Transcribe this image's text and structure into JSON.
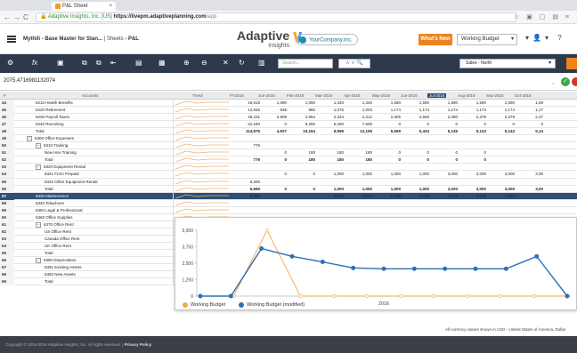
{
  "browser": {
    "tab_title": "P&L Sheet",
    "url_lock": "Adaptive Insights, Inc. [US]",
    "url_domain": "https://livepm.adaptiveplanning.com",
    "url_path": "/app"
  },
  "header": {
    "breadcrumb_model": "Mythili - Base Master for Stan...",
    "breadcrumb_sheets": "Sheets",
    "breadcrumb_page": "P&L",
    "logo_main": "Adaptive",
    "logo_sub": "insights",
    "company_logo": "YourCompany.inc.",
    "whats_new": "What's New",
    "version_select": "Working Budget"
  },
  "toolbar": {
    "search_placeholder": "Search...",
    "region_select": "Sales - North"
  },
  "formula_bar": {
    "value": "2075.4716981132074"
  },
  "grid": {
    "headers": {
      "rownum": "#",
      "accounts": "Accounts",
      "trend": "Trend",
      "fy": "FY2015",
      "months": [
        "Jun-2016",
        "Feb-2016",
        "Mar-2016",
        "Apr-2016",
        "May-2016",
        "Jun-2016",
        "Jul-2016",
        "Aug-2016",
        "Sep-2016",
        "Oct-2016"
      ]
    },
    "rows": [
      {
        "num": "44",
        "label": "6210 Health Benefits",
        "indent": 2,
        "fy": "19,818",
        "v": [
          "1,090",
          "1,090",
          "1,340",
          "1,340",
          "1,590",
          "1,590",
          "1,590",
          "1,590",
          "1,590",
          "1,59"
        ]
      },
      {
        "num": "45",
        "label": "6220 Retirement",
        "indent": 2,
        "fy": "14,946",
        "v": [
          "938",
          "960",
          "1,075",
          "1,003",
          "1,174",
          "1,174",
          "1,174",
          "1,174",
          "1,174",
          "1,17"
        ]
      },
      {
        "num": "46",
        "label": "6230 Payroll Taxes",
        "indent": 2,
        "fy": "49,231",
        "v": [
          "2,909",
          "2,864",
          "2,334",
          "2,312",
          "2,805",
          "2,669",
          "2,380",
          "2,379",
          "2,379",
          "2,37"
        ]
      },
      {
        "num": "47",
        "label": "6240 Recruiting",
        "indent": 2,
        "fy": "31,180",
        "v": [
          "0",
          "5,250",
          "5,250",
          "7,500",
          "0",
          "0",
          "0",
          "0",
          "0",
          "0"
        ]
      },
      {
        "num": "48",
        "label": "Total",
        "indent": 2,
        "fy": "114,976",
        "bold": true,
        "v": [
          "4,937",
          "10,164",
          "9,999",
          "12,155",
          "5,569",
          "5,434",
          "5,145",
          "5,143",
          "5,143",
          "5,14"
        ]
      },
      {
        "num": "49",
        "label": "6300 Office Expenses",
        "indent": 1,
        "toggle": "−",
        "fy": "",
        "v": [
          "",
          "",
          "",
          "",
          "",
          "",
          "",
          "",
          "",
          ""
        ]
      },
      {
        "num": "50",
        "label": "6310 Training",
        "indent": 2,
        "toggle": "−",
        "fy": "776",
        "v": [
          "",
          "",
          "",
          "",
          "",
          "",
          "",
          "",
          "",
          ""
        ]
      },
      {
        "num": "51",
        "label": "New Hire Training",
        "indent": 3,
        "fy": "",
        "v": [
          "0",
          "180",
          "180",
          "180",
          "0",
          "0",
          "0",
          "0",
          "",
          ""
        ]
      },
      {
        "num": "52",
        "label": "Total",
        "indent": 3,
        "fy": "776",
        "bold": true,
        "v": [
          "0",
          "180",
          "180",
          "180",
          "0",
          "0",
          "0",
          "0",
          "",
          ""
        ]
      },
      {
        "num": "53",
        "label": "6320 Equipment Rental",
        "indent": 2,
        "toggle": "−",
        "fy": "",
        "v": [
          "",
          "",
          "",
          "",
          "",
          "",
          "",
          "",
          "",
          ""
        ]
      },
      {
        "num": "54",
        "label": "6321 From Prepaid",
        "indent": 3,
        "fy": "",
        "v": [
          "0",
          "0",
          "1,000",
          "1,000",
          "1,000",
          "1,000",
          "3,000",
          "3,000",
          "3,000",
          "3,00"
        ]
      },
      {
        "num": "55",
        "label": "6322 Other Equipment Rental",
        "indent": 3,
        "fy": "6,590",
        "v": [
          "",
          "",
          "",
          "",
          "",
          "",
          "",
          "",
          "",
          ""
        ]
      },
      {
        "num": "56",
        "label": "Total",
        "indent": 3,
        "fy": "6,590",
        "bold": true,
        "v": [
          "0",
          "0",
          "1,000",
          "1,000",
          "1,000",
          "1,000",
          "3,000",
          "3,000",
          "3,000",
          "3,00"
        ]
      },
      {
        "num": "57",
        "label": "6330 Maintenance",
        "indent": 2,
        "selected": true,
        "fy": "3,700",
        "v": [
          "",
          "",
          "3,616",
          "3,019",
          "2,138",
          "2,075",
          "2,075",
          "2,075",
          "3,019",
          ""
        ]
      },
      {
        "num": "58",
        "label": "6340 Telephone",
        "indent": 2,
        "fy": "",
        "v": [
          "",
          "",
          "",
          "",
          "",
          "",
          "",
          "",
          "",
          ""
        ]
      },
      {
        "num": "59",
        "label": "6350 Legal & Professional",
        "indent": 2,
        "fy": "",
        "v": [
          "",
          "",
          "",
          "",
          "",
          "",
          "",
          "",
          "",
          ""
        ]
      },
      {
        "num": "60",
        "label": "6360 Office Supplies",
        "indent": 2,
        "fy": "",
        "v": [
          "",
          "",
          "",
          "",
          "",
          "",
          "",
          "",
          "",
          ""
        ]
      },
      {
        "num": "61",
        "label": "6370 Office Rent",
        "indent": 2,
        "toggle": "−",
        "fy": "",
        "v": [
          "",
          "",
          "",
          "",
          "",
          "",
          "",
          "",
          "",
          ""
        ]
      },
      {
        "num": "62",
        "label": "US Office Rent",
        "indent": 3,
        "fy": "",
        "v": [
          "",
          "",
          "",
          "",
          "",
          "",
          "",
          "",
          "",
          ""
        ]
      },
      {
        "num": "63",
        "label": "Canada Office Rent",
        "indent": 3,
        "fy": "",
        "v": [
          "",
          "",
          "",
          "",
          "",
          "",
          "",
          "",
          "",
          ""
        ]
      },
      {
        "num": "64",
        "label": "UK Office Rent",
        "indent": 3,
        "fy": "",
        "v": [
          "",
          "",
          "",
          "",
          "",
          "",
          "",
          "",
          "",
          ""
        ]
      },
      {
        "num": "65",
        "label": "Total",
        "indent": 3,
        "fy": "",
        "v": [
          "",
          "",
          "",
          "",
          "",
          "",
          "",
          "",
          "",
          ""
        ]
      },
      {
        "num": "66",
        "label": "6380 Depreciation",
        "indent": 2,
        "toggle": "−",
        "fy": "",
        "v": [
          "",
          "",
          "",
          "",
          "",
          "",
          "",
          "",
          "",
          ""
        ]
      },
      {
        "num": "67",
        "label": "6381 Existing Assets",
        "indent": 3,
        "fy": "",
        "v": [
          "",
          "",
          "",
          "",
          "",
          "",
          "",
          "",
          "",
          ""
        ]
      },
      {
        "num": "68",
        "label": "6382 New Assets",
        "indent": 3,
        "fy": "",
        "v": [
          "",
          "",
          "",
          "",
          "",
          "",
          "",
          "",
          "",
          ""
        ]
      },
      {
        "num": "69",
        "label": "Total",
        "indent": 3,
        "fy": "",
        "v": [
          "",
          "",
          "",
          "",
          "",
          "",
          "",
          "",
          "",
          ""
        ]
      }
    ]
  },
  "chart_data": {
    "type": "line",
    "xlabel": "2016",
    "ylim": [
      0,
      5000
    ],
    "yticks": [
      "0",
      "1,250",
      "2,500",
      "3,750",
      "5,000"
    ],
    "series": [
      {
        "name": "Working Budget",
        "color": "#f5a64a",
        "values": [
          0,
          0,
          5000,
          0,
          0,
          0,
          0,
          0,
          0,
          0,
          0,
          0
        ]
      },
      {
        "name": "Working Budget (modified)",
        "color": "#2b71b8",
        "values": [
          0,
          0,
          3616,
          3019,
          2600,
          2138,
          2075,
          2075,
          2075,
          2075,
          2075,
          3019,
          0
        ]
      }
    ]
  },
  "footer": {
    "note": "All currency values shown in USD - United States of America, Dollar",
    "copyright": "Copyright © 2004-2016 Adaptive Insights, Inc. All rights reserved. |",
    "privacy": "Privacy Policy"
  }
}
